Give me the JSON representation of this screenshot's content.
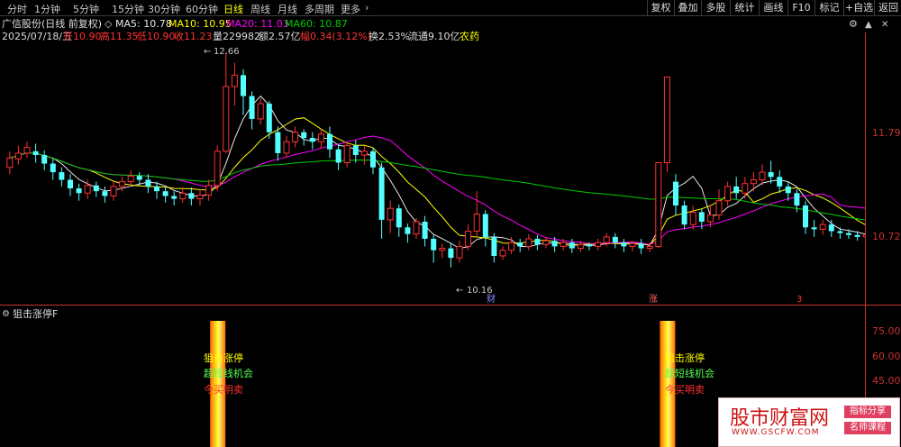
{
  "toolbar": {
    "periods": [
      "分时",
      "1分钟",
      "5分钟",
      "15分钟",
      "30分钟",
      "60分钟",
      "日线",
      "周线",
      "月线",
      "多周期",
      "更多"
    ],
    "active_period": "日线",
    "right_buttons": [
      "复权",
      "叠加",
      "多股",
      "统计",
      "画线",
      "F10",
      "标记",
      "+自选",
      "返回"
    ]
  },
  "stock": {
    "title": "广信股份(日线 前复权)",
    "ma": {
      "ma5": "MA5: 10.78",
      "ma10": "MA10: 10.95",
      "ma20": "MA20: 11.03",
      "ma60": "MA60: 10.87"
    },
    "date": "2025/07/18/五",
    "open": "开10.90",
    "high": "高11.35",
    "low": "低10.90",
    "close": "收11.23",
    "volume": "量229982",
    "amount": "额2.57亿",
    "change": "幅0.34(3.12%)",
    "turnover": "换2.53%",
    "float": "流通9.10亿",
    "sector": "农药"
  },
  "price_axis": {
    "upper": "11.79",
    "lower": "10.72"
  },
  "annotations": {
    "max_price": "12.66",
    "min_price": "10.16",
    "marker_cai": "财",
    "marker_zhang": "涨",
    "marker_3": "3"
  },
  "indicator": {
    "title": "狙击涨停F",
    "signal_lines": [
      "狙击涨停",
      "超短线机会",
      "今买明卖"
    ],
    "axis": [
      "75.00",
      "60.00",
      "45.00"
    ]
  },
  "watermark": {
    "title": "股市财富网",
    "url": "WWW.GSCFW.COM",
    "tag1": "指标分享",
    "tag2": "名师课程"
  },
  "colors": {
    "up": "#ff3232",
    "down": "#54ffff",
    "ma5": "#e8e8e8",
    "ma10": "#ffff00",
    "ma20": "#ff00ff",
    "ma60": "#00cc00"
  },
  "chart_data": {
    "type": "candlestick",
    "price_range": [
      10.16,
      12.66
    ],
    "candles": [
      [
        11.45,
        11.55,
        11.38,
        11.62
      ],
      [
        11.54,
        11.6,
        11.48,
        11.68
      ],
      [
        11.6,
        11.66,
        11.55,
        11.72
      ],
      [
        11.62,
        11.58,
        11.5,
        11.7
      ],
      [
        11.58,
        11.49,
        11.42,
        11.63
      ],
      [
        11.49,
        11.4,
        11.32,
        11.55
      ],
      [
        11.4,
        11.32,
        11.25,
        11.45
      ],
      [
        11.32,
        11.23,
        11.15,
        11.38
      ],
      [
        11.23,
        11.18,
        11.1,
        11.28
      ],
      [
        11.18,
        11.26,
        11.12,
        11.32
      ],
      [
        11.26,
        11.2,
        11.14,
        11.3
      ],
      [
        11.2,
        11.15,
        11.08,
        11.25
      ],
      [
        11.15,
        11.25,
        11.1,
        11.3
      ],
      [
        11.25,
        11.3,
        11.2,
        11.35
      ],
      [
        11.3,
        11.36,
        11.25,
        11.42
      ],
      [
        11.36,
        11.32,
        11.26,
        11.4
      ],
      [
        11.32,
        11.25,
        11.18,
        11.38
      ],
      [
        11.25,
        11.2,
        11.12,
        11.3
      ],
      [
        11.2,
        11.15,
        11.08,
        11.25
      ],
      [
        11.15,
        11.12,
        11.05,
        11.2
      ],
      [
        11.12,
        11.18,
        11.08,
        11.24
      ],
      [
        11.18,
        11.12,
        11.05,
        11.24
      ],
      [
        11.12,
        11.16,
        11.05,
        11.22
      ],
      [
        11.16,
        11.26,
        11.1,
        11.32
      ],
      [
        11.26,
        11.62,
        11.2,
        11.68
      ],
      [
        11.62,
        12.3,
        11.6,
        12.66
      ],
      [
        12.3,
        12.42,
        12.1,
        12.55
      ],
      [
        12.42,
        12.2,
        12.0,
        12.48
      ],
      [
        12.2,
        11.96,
        11.85,
        12.25
      ],
      [
        11.96,
        12.12,
        11.9,
        12.18
      ],
      [
        12.12,
        11.82,
        11.75,
        12.15
      ],
      [
        11.82,
        11.6,
        11.52,
        11.88
      ],
      [
        11.6,
        11.72,
        11.55,
        11.78
      ],
      [
        11.72,
        11.82,
        11.66,
        11.88
      ],
      [
        11.82,
        11.76,
        11.68,
        11.85
      ],
      [
        11.76,
        11.72,
        11.64,
        11.82
      ],
      [
        11.72,
        11.8,
        11.65,
        11.85
      ],
      [
        11.8,
        11.64,
        11.55,
        11.88
      ],
      [
        11.64,
        11.5,
        11.42,
        11.7
      ],
      [
        11.5,
        11.68,
        11.45,
        11.72
      ],
      [
        11.68,
        11.58,
        11.5,
        11.74
      ],
      [
        11.58,
        11.62,
        11.48,
        11.68
      ],
      [
        11.62,
        11.45,
        11.38,
        11.66
      ],
      [
        11.45,
        10.9,
        10.7,
        11.5
      ],
      [
        10.9,
        11.02,
        10.76,
        11.1
      ],
      [
        11.02,
        10.82,
        10.72,
        11.06
      ],
      [
        10.82,
        10.75,
        10.66,
        10.86
      ],
      [
        10.75,
        10.88,
        10.7,
        10.92
      ],
      [
        10.88,
        10.7,
        10.62,
        10.94
      ],
      [
        10.7,
        10.58,
        10.45,
        10.74
      ],
      [
        10.58,
        10.6,
        10.5,
        10.65
      ],
      [
        10.6,
        10.5,
        10.4,
        10.66
      ],
      [
        10.5,
        10.62,
        10.45,
        10.68
      ],
      [
        10.62,
        10.78,
        10.58,
        10.85
      ],
      [
        10.78,
        10.96,
        10.72,
        11.2
      ],
      [
        10.96,
        10.72,
        10.62,
        11.0
      ],
      [
        10.72,
        10.52,
        10.45,
        10.76
      ],
      [
        10.52,
        10.58,
        10.48,
        10.62
      ],
      [
        10.58,
        10.66,
        10.54,
        10.72
      ],
      [
        10.66,
        10.62,
        10.56,
        10.7
      ],
      [
        10.62,
        10.7,
        10.58,
        10.75
      ],
      [
        10.7,
        10.64,
        10.58,
        10.74
      ],
      [
        10.64,
        10.68,
        10.6,
        10.72
      ],
      [
        10.68,
        10.62,
        10.56,
        10.72
      ],
      [
        10.62,
        10.66,
        10.58,
        10.7
      ],
      [
        10.66,
        10.6,
        10.55,
        10.7
      ],
      [
        10.6,
        10.64,
        10.56,
        10.68
      ],
      [
        10.64,
        10.62,
        10.58,
        10.66
      ],
      [
        10.62,
        10.66,
        10.58,
        10.7
      ],
      [
        10.66,
        10.72,
        10.62,
        10.76
      ],
      [
        10.72,
        10.66,
        10.6,
        10.76
      ],
      [
        10.66,
        10.62,
        10.56,
        10.7
      ],
      [
        10.62,
        10.65,
        10.57,
        10.68
      ],
      [
        10.65,
        10.6,
        10.54,
        10.7
      ],
      [
        10.6,
        10.62,
        10.56,
        10.66
      ],
      [
        10.62,
        11.5,
        10.6,
        11.5
      ],
      [
        11.5,
        12.4,
        11.4,
        12.4
      ],
      [
        11.3,
        11.05,
        10.95,
        11.38
      ],
      [
        11.05,
        10.85,
        10.8,
        11.1
      ],
      [
        10.85,
        10.98,
        10.8,
        11.05
      ],
      [
        10.98,
        10.88,
        10.8,
        11.02
      ],
      [
        10.88,
        10.95,
        10.82,
        11.05
      ],
      [
        10.95,
        11.1,
        10.9,
        11.22
      ],
      [
        11.1,
        11.25,
        11.05,
        11.3
      ],
      [
        11.25,
        11.18,
        11.12,
        11.35
      ],
      [
        11.18,
        11.28,
        11.12,
        11.35
      ],
      [
        11.28,
        11.32,
        11.2,
        11.4
      ],
      [
        11.32,
        11.4,
        11.26,
        11.48
      ],
      [
        11.4,
        11.35,
        11.28,
        11.52
      ],
      [
        11.35,
        11.25,
        11.18,
        11.42
      ],
      [
        11.25,
        11.18,
        11.1,
        11.3
      ],
      [
        11.18,
        11.05,
        10.98,
        11.22
      ],
      [
        11.05,
        10.82,
        10.75,
        11.1
      ],
      [
        10.82,
        10.8,
        10.72,
        10.9
      ],
      [
        10.8,
        10.85,
        10.74,
        10.9
      ],
      [
        10.85,
        10.78,
        10.72,
        10.9
      ],
      [
        10.78,
        10.76,
        10.7,
        10.82
      ],
      [
        10.76,
        10.74,
        10.7,
        10.8
      ],
      [
        10.74,
        10.72,
        10.68,
        10.78
      ],
      [
        10.72,
        10.74,
        10.68,
        10.78
      ]
    ],
    "ma_periods": [
      5,
      10,
      20,
      60
    ],
    "indicator_signals": [
      24,
      76
    ]
  }
}
